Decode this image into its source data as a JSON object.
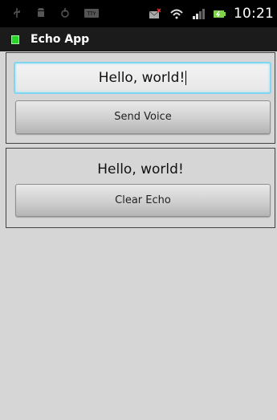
{
  "status_bar": {
    "time": "10:21",
    "icons": [
      "usb-icon",
      "android-debug-icon",
      "sync-icon",
      "tty-icon",
      "mail-muted-icon",
      "wifi-icon",
      "signal-icon",
      "battery-icon"
    ]
  },
  "app": {
    "title": "Echo App",
    "accent_color": "#27d627"
  },
  "input_section": {
    "text_value": "Hello, world!",
    "send_button_label": "Send Voice"
  },
  "echo_section": {
    "echo_text": "Hello, world!",
    "clear_button_label": "Clear Echo"
  }
}
